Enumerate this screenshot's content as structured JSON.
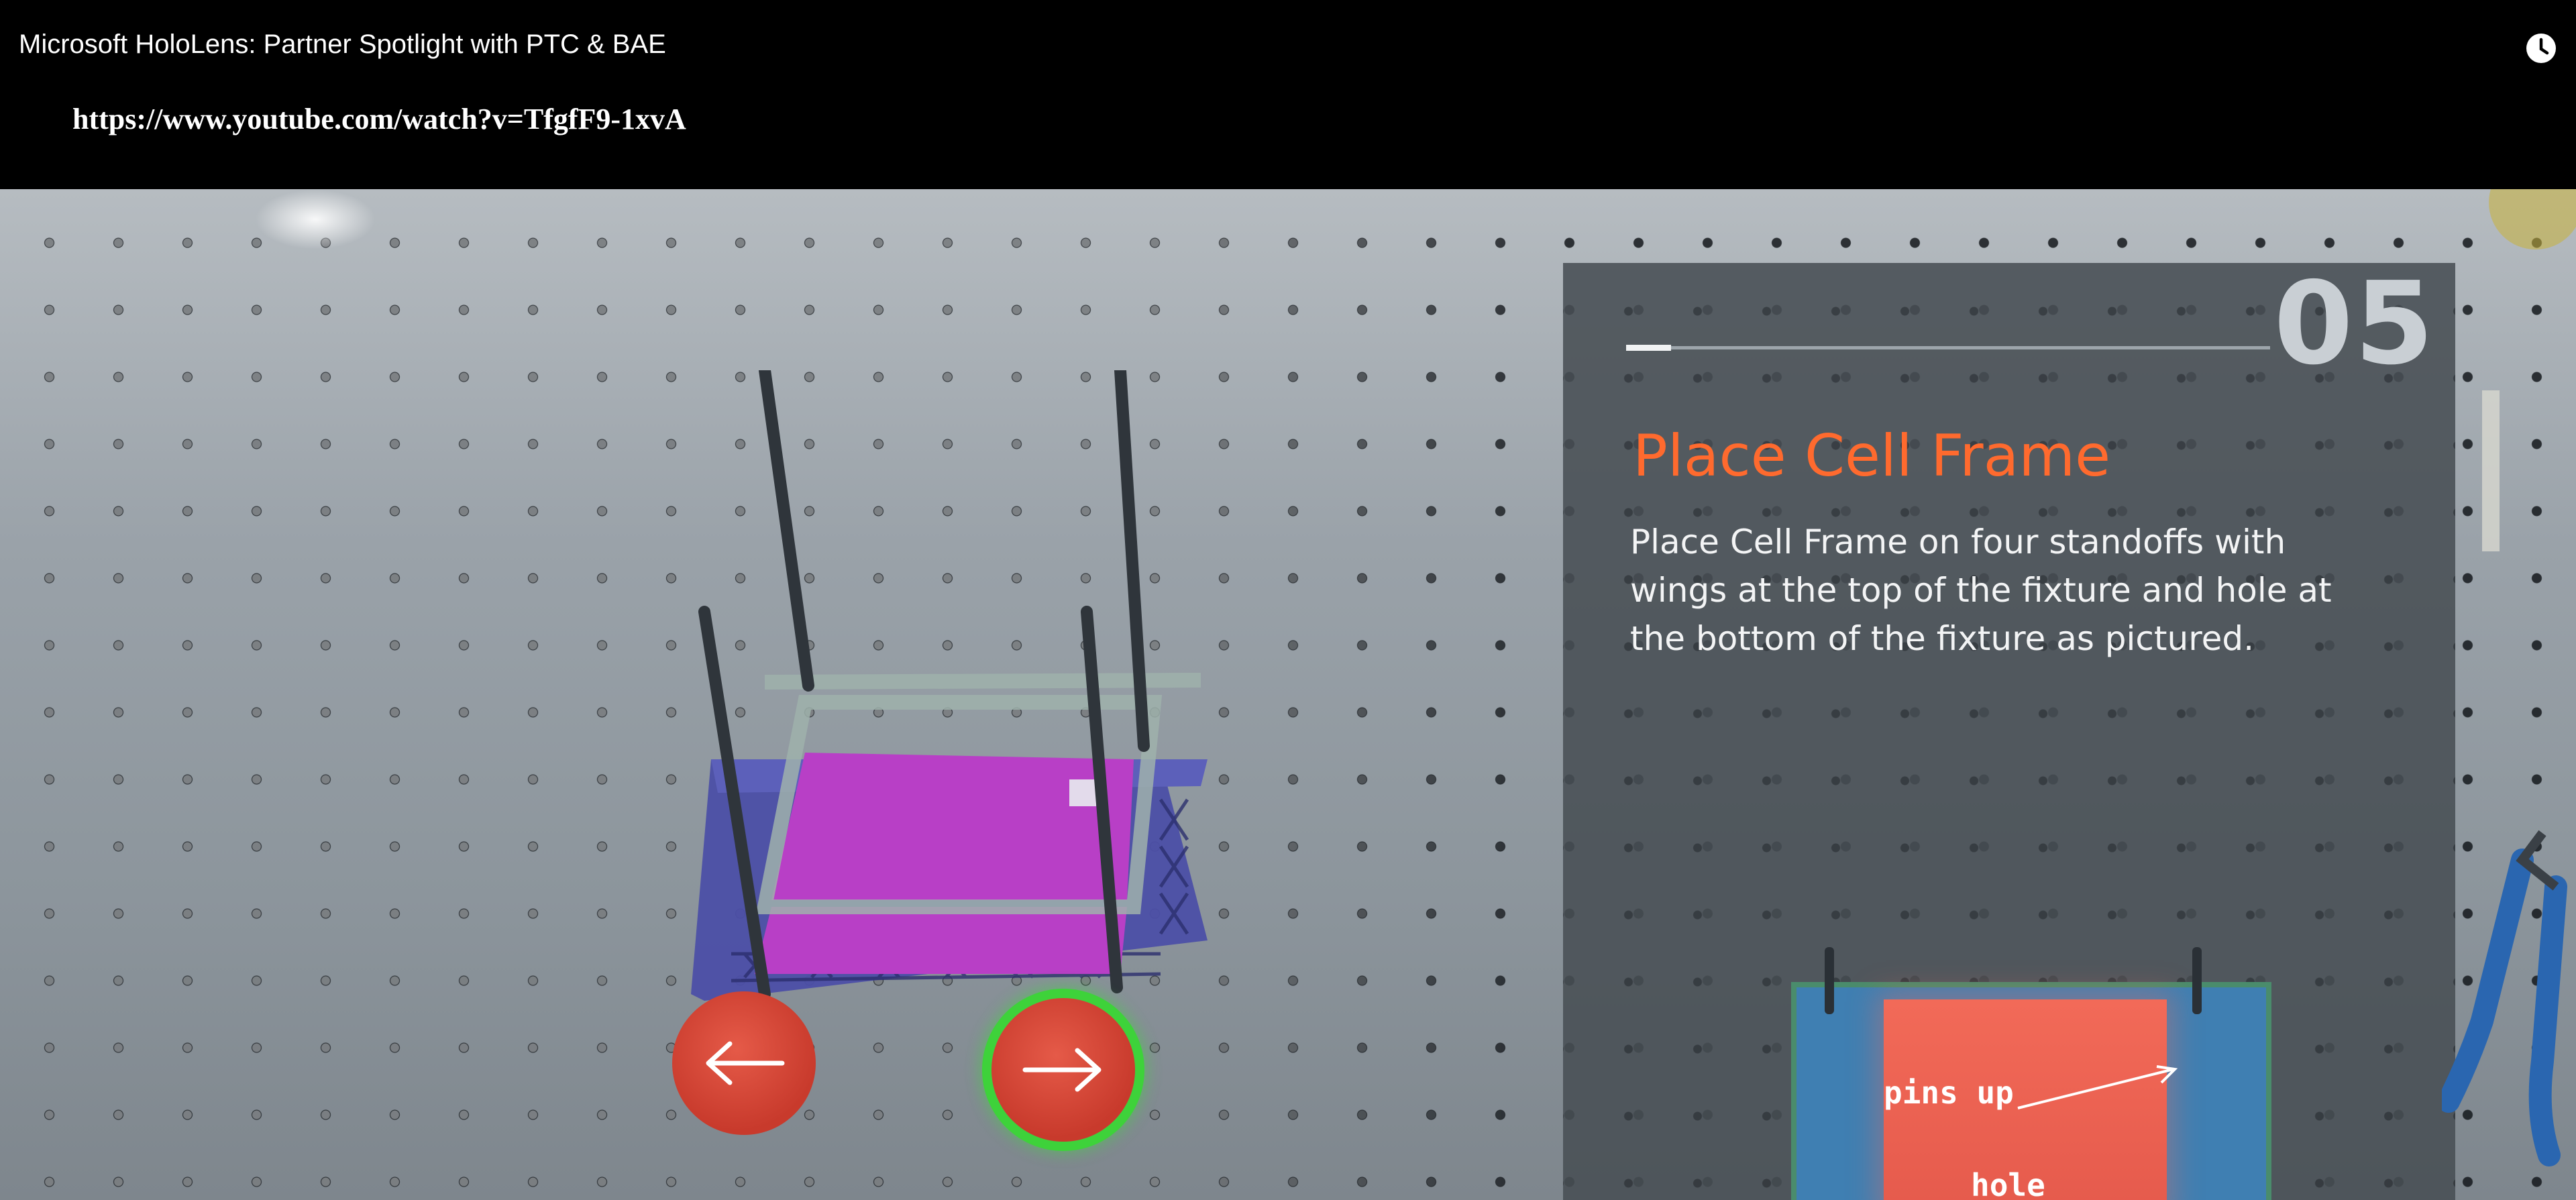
{
  "window": {
    "title": "Microsoft HoloLens: Partner Spotlight with PTC & BAE",
    "url": "https://www.youtube.com/watch?v=TfgfF9-1xvA"
  },
  "icons": {
    "watch_later": "clock-icon",
    "prev": "arrow-left-icon",
    "next": "arrow-right-icon"
  },
  "instruction": {
    "step_number": "05",
    "progress": 0.07,
    "title": "Place Cell Frame",
    "description": "Place Cell Frame on four standoffs with wings at the top of the fixture and hole at the bottom of the fixture as pictured.",
    "image_labels": {
      "pins": "pins up",
      "hole": "hole"
    }
  },
  "colors": {
    "title_orange": "#ff6a2e",
    "nav_red": "#d8483a",
    "next_ring_green": "#3ed23a",
    "tray_magenta": "#b23cc4",
    "tray_blue": "#4a4ea8"
  }
}
